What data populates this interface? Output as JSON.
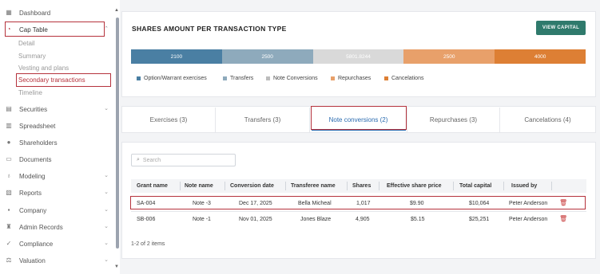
{
  "sidebar": {
    "items": [
      {
        "label": "Dashboard",
        "icon": "dashboard-icon"
      },
      {
        "label": "Cap Table",
        "icon": "pie-chart-icon"
      },
      {
        "label": "Securities",
        "icon": "securities-icon"
      },
      {
        "label": "Spreadsheet",
        "icon": "spreadsheet-icon"
      },
      {
        "label": "Shareholders",
        "icon": "person-icon"
      },
      {
        "label": "Documents",
        "icon": "document-icon"
      },
      {
        "label": "Modeling",
        "icon": "lightbulb-icon"
      },
      {
        "label": "Reports",
        "icon": "reports-icon"
      },
      {
        "label": "Company",
        "icon": "company-icon"
      },
      {
        "label": "Admin Records",
        "icon": "admin-icon"
      },
      {
        "label": "Compliance",
        "icon": "compliance-icon"
      },
      {
        "label": "Valuation",
        "icon": "valuation-icon"
      }
    ],
    "cap_sub": [
      "Detail",
      "Summary",
      "Vesting and plans",
      "Secondary transactions",
      "Timeline"
    ]
  },
  "summary": {
    "title": "SHARES AMOUNT PER TRANSACTION TYPE",
    "button": "VIEW CAPITAL",
    "segments": [
      {
        "label": "2100",
        "value": 2100,
        "color": "#4a7fa3"
      },
      {
        "label": "2500",
        "value": 2500,
        "color": "#8eaabc"
      },
      {
        "label": "5801.8244",
        "value": 5801.8244,
        "color": "#d9d9d9"
      },
      {
        "label": "2500",
        "value": 2500,
        "color": "#e8a06a"
      },
      {
        "label": "4000",
        "value": 4000,
        "color": "#dd7f34"
      }
    ],
    "legend": [
      {
        "label": "Option/Warrant exercises",
        "color": "#4a7fa3"
      },
      {
        "label": "Transfers",
        "color": "#8eaabc"
      },
      {
        "label": "Note Conversions",
        "color": "#bdbdbd"
      },
      {
        "label": "Repurchases",
        "color": "#e8a06a"
      },
      {
        "label": "Cancelations",
        "color": "#dd7f34"
      }
    ]
  },
  "tabs": [
    "Exercises (3)",
    "Transfers (3)",
    "Note conversions (2)",
    "Repurchases (3)",
    "Cancelations (4)"
  ],
  "table": {
    "search_placeholder": "Search",
    "headers": [
      "Grant name",
      "Note name",
      "Conversion date",
      "Transferee name",
      "Shares",
      "Effective share price",
      "Total capital",
      "Issued by"
    ],
    "rows": [
      [
        "SA-004",
        "Note -3",
        "Dec 17, 2025",
        "Bella Micheal",
        "1,017",
        "$9.90",
        "$10,064",
        "Peter Anderson"
      ],
      [
        "SB-006",
        "Note -1",
        "Nov 01, 2025",
        "Jones Blaze",
        "4,905",
        "$5.15",
        "$25,251",
        "Peter Anderson"
      ]
    ],
    "pager": "1-2 of 2 items"
  }
}
